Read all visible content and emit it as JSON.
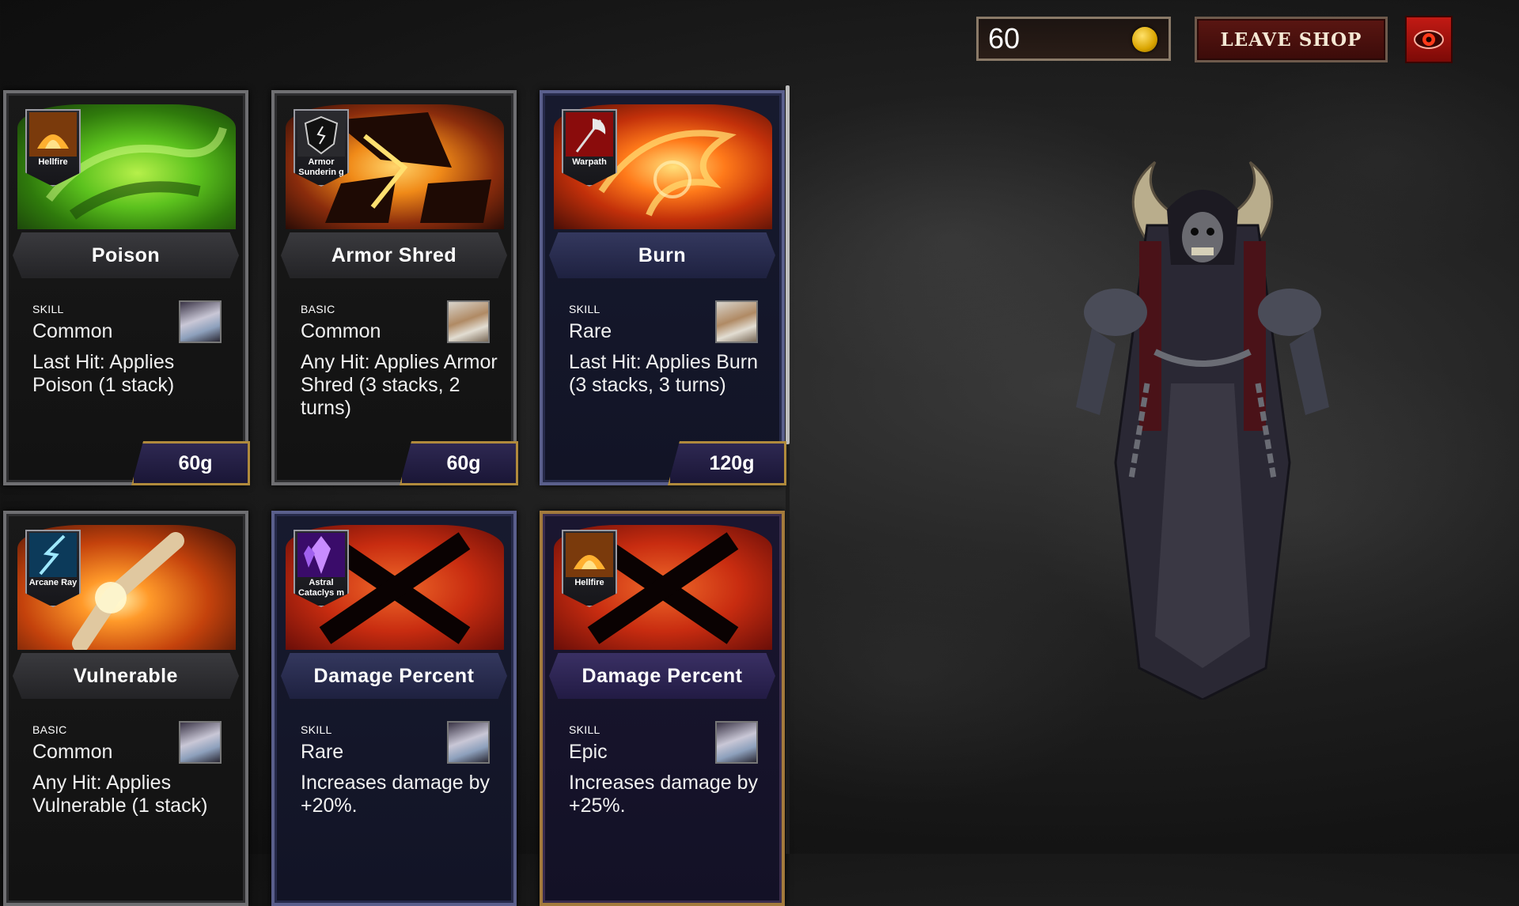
{
  "topbar": {
    "gold": "60",
    "leave_label": "LEAVE SHOP"
  },
  "cards": [
    {
      "badge": "Hellfire",
      "title": "Poison",
      "type": "SKILL",
      "rarity": "Common",
      "desc": "Last Hit: Applies Poison (1 stack)",
      "price": "60g"
    },
    {
      "badge": "Armor Sunderin g",
      "title": "Armor Shred",
      "type": "BASIC",
      "rarity": "Common",
      "desc": "Any Hit: Applies Armor Shred (3 stacks, 2 turns)",
      "price": "60g"
    },
    {
      "badge": "Warpath",
      "title": "Burn",
      "type": "SKILL",
      "rarity": "Rare",
      "desc": "Last Hit: Applies Burn (3 stacks, 3 turns)",
      "price": "120g"
    },
    {
      "badge": "Arcane Ray",
      "title": "Vulnerable",
      "type": "BASIC",
      "rarity": "Common",
      "desc": "Any Hit: Applies Vulnerable (1 stack)"
    },
    {
      "badge": "Astral Cataclys m",
      "title": "Damage Percent",
      "type": "SKILL",
      "rarity": "Rare",
      "desc": "Increases damage by +20%."
    },
    {
      "badge": "Hellfire",
      "title": "Damage Percent",
      "type": "SKILL",
      "rarity": "Epic",
      "desc": "Increases damage by +25%."
    }
  ]
}
